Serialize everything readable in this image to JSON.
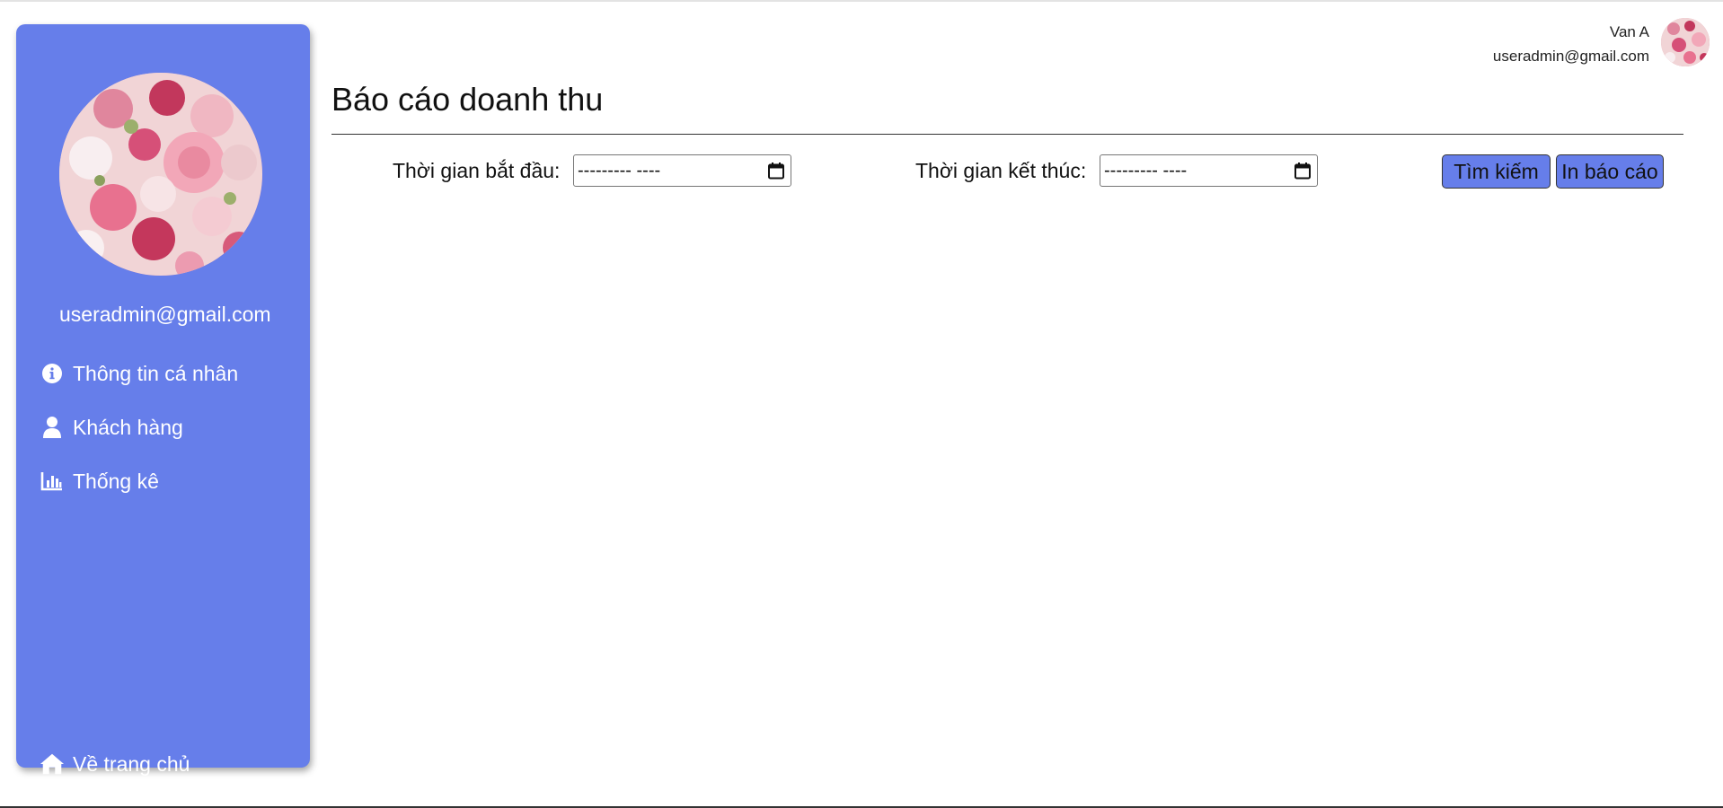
{
  "sidebar": {
    "email": "useradmin@gmail.com",
    "items": [
      {
        "label": "Thông tin cá nhân",
        "icon": "info-circle-icon"
      },
      {
        "label": "Khách hàng",
        "icon": "user-icon"
      },
      {
        "label": "Thống kê",
        "icon": "bar-chart-icon"
      }
    ],
    "home": {
      "label": "Về trang chủ",
      "icon": "home-icon"
    },
    "background_color": "#667eea"
  },
  "header": {
    "user_name": "Van A",
    "user_email": "useradmin@gmail.com"
  },
  "main": {
    "title": "Báo cáo doanh thu",
    "filters": {
      "start_label": "Thời gian bắt đầu:",
      "start_value": "--------- ----",
      "end_label": "Thời gian kết thúc:",
      "end_value": "--------- ----"
    },
    "buttons": {
      "search": "Tìm kiếm",
      "print": "In báo cáo"
    },
    "button_color": "#667eea"
  }
}
